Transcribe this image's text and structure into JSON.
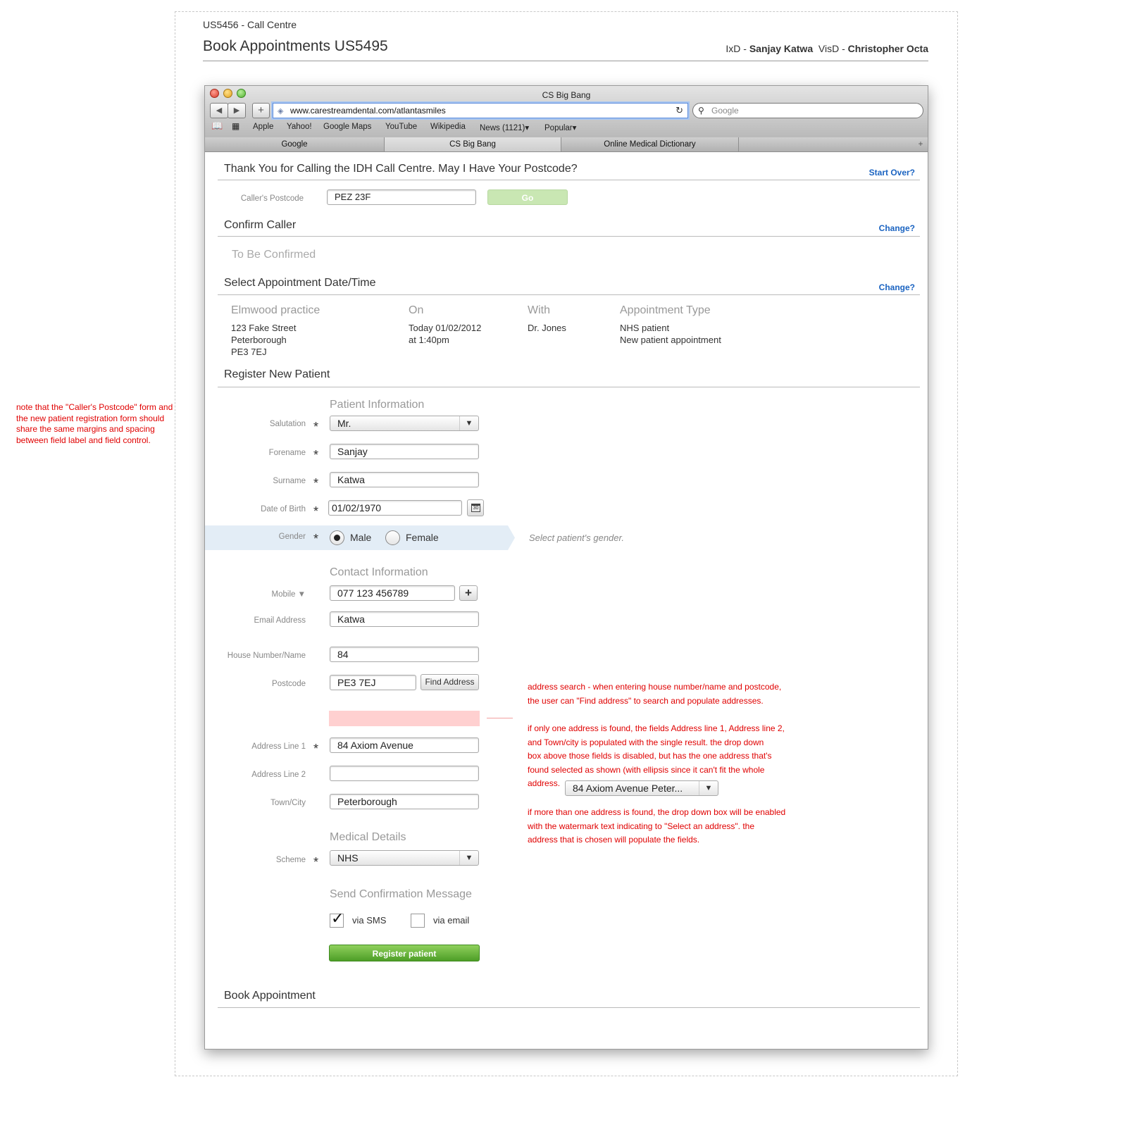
{
  "header": {
    "story": "US5456 - Call Centre",
    "title": "Book Appointments US5495",
    "ixd_label": "IxD -",
    "ixd_name": "Sanjay Katwa",
    "visd_label": "VisD -",
    "visd_name": "Christopher Octa"
  },
  "side_note": "note that the \"Caller's Postcode\" form and the new patient registration form should share the same margins and spacing between field label and field control.",
  "browser": {
    "title": "CS Big Bang",
    "url": "www.carestreamdental.com/atlantasmiles",
    "search_placeholder": "Google",
    "bookmarks": [
      "Apple",
      "Yahoo!",
      "Google Maps",
      "YouTube",
      "Wikipedia",
      "News (1121)▾",
      "Popular▾"
    ],
    "tabs": [
      "Google",
      "CS Big Bang",
      "Online Medical Dictionary"
    ],
    "new_tab": "+"
  },
  "postcode_section": {
    "title": "Thank You for Calling the IDH Call Centre. May I Have Your Postcode?",
    "start_over": "Start Over?",
    "label": "Caller's Postcode",
    "value": "PEZ 23F",
    "go": "Go"
  },
  "confirm_caller": {
    "title": "Confirm Caller",
    "change": "Change?",
    "status": "To Be Confirmed"
  },
  "appointment": {
    "title": "Select Appointment Date/Time",
    "change": "Change?",
    "practice_head": "Elmwood practice",
    "practice_lines": [
      "123 Fake Street",
      "Peterborough",
      "PE3 7EJ"
    ],
    "on_head": "On",
    "on_lines": [
      "Today 01/02/2012",
      "at 1:40pm"
    ],
    "with_head": "With",
    "with_lines": [
      "Dr. Jones"
    ],
    "type_head": "Appointment Type",
    "type_lines": [
      "NHS patient",
      "New patient appointment"
    ]
  },
  "register": {
    "title": "Register New Patient",
    "patient_info": "Patient Information",
    "salutation_label": "Salutation",
    "salutation_value": "Mr.",
    "forename_label": "Forename",
    "forename_value": "Sanjay",
    "surname_label": "Surname",
    "surname_value": "Katwa",
    "dob_label": "Date of Birth",
    "dob_value": "01/02/1970",
    "calendar_day": "30",
    "gender_label": "Gender",
    "gender_male": "Male",
    "gender_female": "Female",
    "gender_hint": "Select patient's gender.",
    "contact_info": "Contact Information",
    "mobile_label": "Mobile ▼",
    "mobile_value": "077 123 456789",
    "add_phone": "+",
    "email_label": "Email Address",
    "email_value": "Katwa",
    "house_label": "House Number/Name",
    "house_value": "84",
    "postcode_label": "Postcode",
    "postcode_value": "PE3 7EJ",
    "find_address": "Find Address",
    "address1_label": "Address Line 1",
    "address1_value": "84 Axiom Avenue",
    "address2_label": "Address Line 2",
    "address2_value": "",
    "town_label": "Town/City",
    "town_value": "Peterborough",
    "medical_details": "Medical Details",
    "scheme_label": "Scheme",
    "scheme_value": "NHS",
    "confirmation": "Send Confirmation Message",
    "via_sms": "via SMS",
    "via_email": "via email",
    "sms_checked": true,
    "email_checked": false,
    "register_button": "Register patient",
    "required_mark": "*"
  },
  "book_appointment": {
    "title": "Book Appointment"
  },
  "annotations": {
    "address_search": [
      "address search - when entering house number/name and postcode,",
      "the user can \"Find address\" to search and populate addresses."
    ],
    "single_result": [
      "if only one address is found, the fields Address line 1, Address line 2,",
      "and Town/city is populated with the single result. the drop down",
      "box above those fields is disabled, but has the one address that's",
      "found selected as shown (with ellipsis since it can't fit the whole",
      "address."
    ],
    "single_result_select": "84 Axiom Avenue Peter...",
    "multiple_results": [
      "if more than one address is found, the drop down box will be enabled",
      "with the watermark text indicating to \"Select an address\". the",
      "address that is chosen will populate the fields."
    ]
  },
  "colors": {
    "link": "#1a63c1",
    "annotation": "#e00000",
    "go_button": "#c8e6b0",
    "register_button": "#5cae34",
    "gender_highlight": "#e3edf6",
    "address_dropdown_placeholder": "#ffd0d0"
  }
}
